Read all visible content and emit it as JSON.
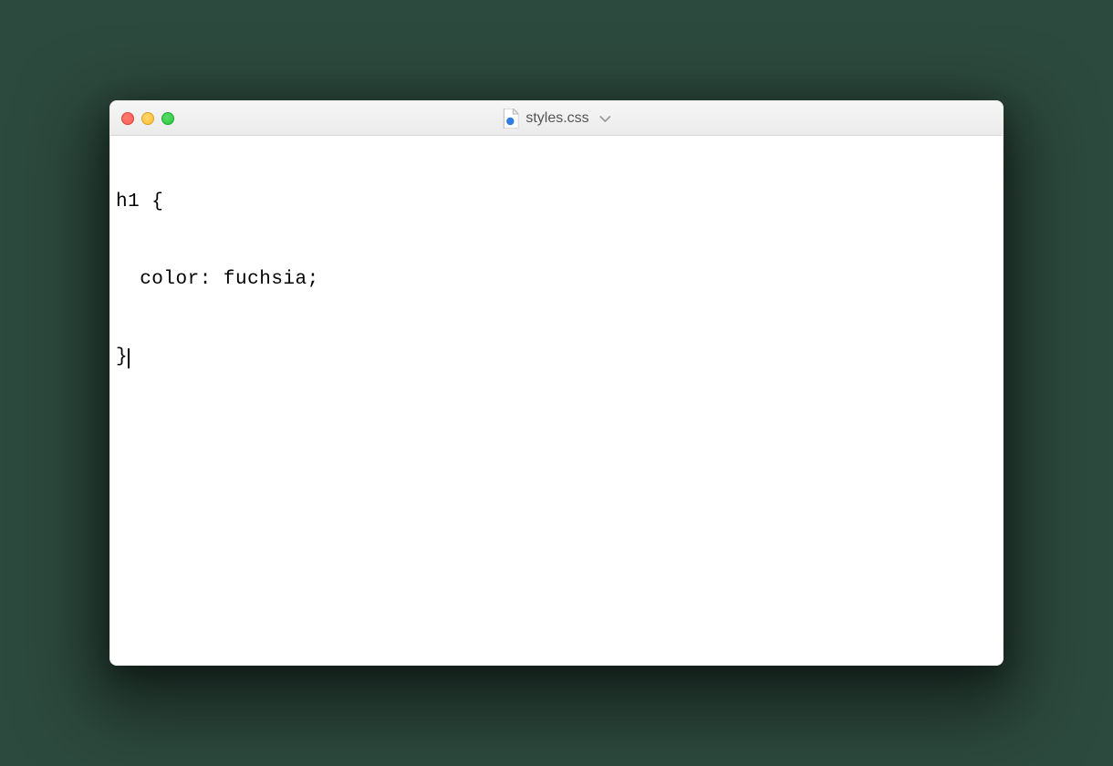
{
  "window": {
    "title": "styles.css",
    "file_icon": "css-file-icon",
    "traffic": {
      "close_color": "#ff5f56",
      "minimize_color": "#ffbd2e",
      "maximize_color": "#27c93f"
    }
  },
  "editor": {
    "lines": [
      "h1 {",
      "  color: fuchsia;",
      "}"
    ],
    "cursor_line": 2,
    "cursor_after_text": true
  }
}
